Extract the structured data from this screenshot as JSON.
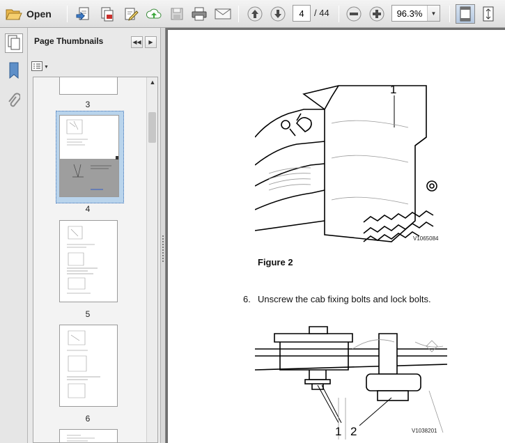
{
  "toolbar": {
    "open_label": "Open",
    "current_page": "4",
    "page_total": "/ 44",
    "zoom_value": "96.3%"
  },
  "panel": {
    "title": "Page Thumbnails"
  },
  "thumbnails": [
    {
      "page": "3"
    },
    {
      "page": "4"
    },
    {
      "page": "5"
    },
    {
      "page": "6"
    }
  ],
  "document": {
    "figure2_caption": "Figure 2",
    "figure2_id": "V1065084",
    "figure2_callout": "1",
    "step_number": "6.",
    "step_text": "Unscrew the cab fixing bolts and lock bolts.",
    "figure3_id": "V1038201",
    "figure3_callout_1": "1",
    "figure3_callout_2": "2"
  },
  "icons": {
    "open": "folder-open-icon",
    "create": "create-pdf-icon",
    "combine": "combine-files-icon",
    "sign": "sign-icon",
    "upload": "upload-icon",
    "save": "save-icon",
    "print": "print-icon",
    "email": "email-icon",
    "prev": "previous-page-icon",
    "next": "next-page-icon",
    "zoom_out": "zoom-out-icon",
    "zoom_in": "zoom-in-icon",
    "fit_page": "fit-page-icon",
    "full_screen": "full-screen-icon"
  }
}
